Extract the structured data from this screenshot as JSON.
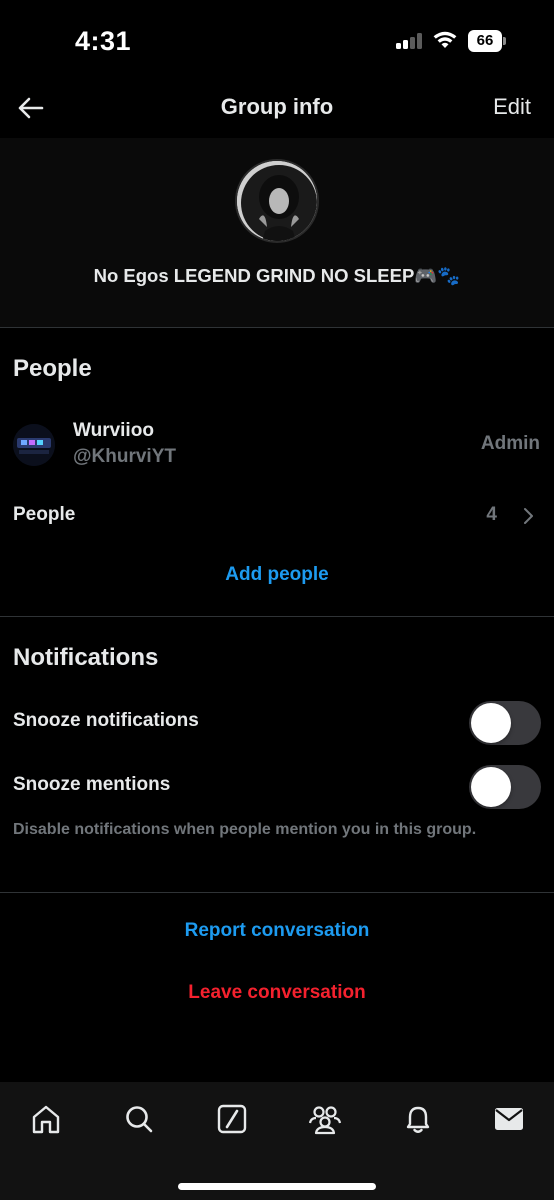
{
  "status_bar": {
    "time": "4:31",
    "battery_level": "66"
  },
  "header": {
    "title": "Group info",
    "back_icon": "arrow-left-icon",
    "edit_label": "Edit"
  },
  "group": {
    "name": "No Egos LEGEND GRIND NO SLEEP🎮🐾",
    "avatar_icon": "group-avatar-image"
  },
  "people_section": {
    "title": "People",
    "members": [
      {
        "name": "Wurviioo",
        "handle": "@KhurviYT",
        "role": "Admin"
      }
    ],
    "people_label": "People",
    "people_count": "4",
    "add_people_label": "Add people"
  },
  "notifications_section": {
    "title": "Notifications",
    "snooze_notifications_label": "Snooze notifications",
    "snooze_notifications_on": false,
    "snooze_mentions_label": "Snooze mentions",
    "snooze_mentions_on": false,
    "helper_text": "Disable notifications when people mention you in this group."
  },
  "actions": {
    "report_label": "Report conversation",
    "leave_label": "Leave conversation"
  },
  "bottom_nav": {
    "items": [
      "home-icon",
      "search-icon",
      "grok-icon",
      "communities-icon",
      "notifications-icon",
      "messages-icon"
    ],
    "active": "messages-icon"
  },
  "colors": {
    "background": "#000000",
    "link_blue": "#1d9bf0",
    "danger_red": "#f4212e",
    "secondary_text": "#71767b",
    "divider": "#2f3336"
  }
}
